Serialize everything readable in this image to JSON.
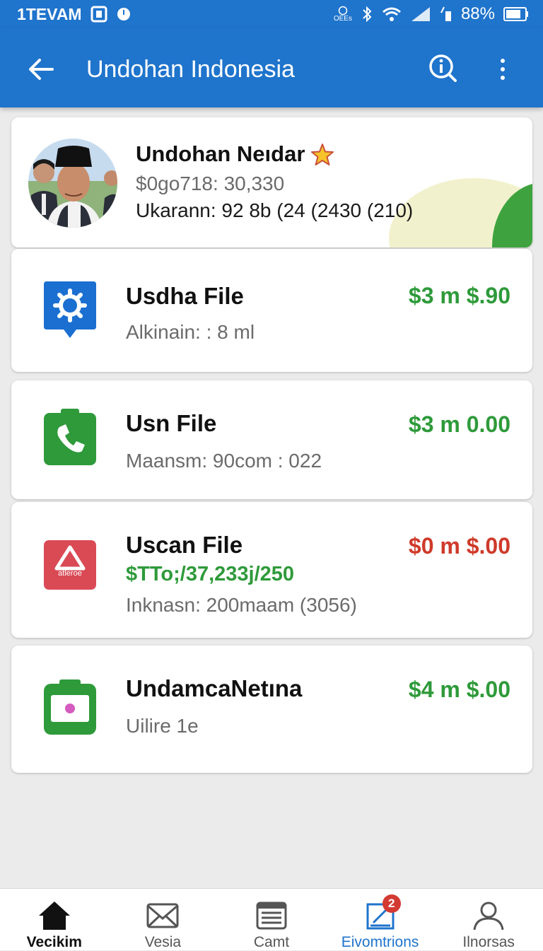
{
  "status_bar": {
    "time": "1TEVAM",
    "mini_label": "OEEs",
    "battery": "88%"
  },
  "app_bar": {
    "title": "Undohan Indonesia",
    "back_icon": "arrow-left-icon",
    "info_icon": "info-search-icon",
    "menu_icon": "more-vertical-icon",
    "color": "#1f74cc"
  },
  "profile": {
    "name": "Undohan Neıdar",
    "line1": "$0go718: 30,330",
    "line2": "Ukarann: 92 8b (24 (2430 (210)"
  },
  "files": [
    {
      "title": "Usdha File",
      "amount": "$3 m $.90",
      "amount_color": "green",
      "subtitle": "Alkinain: : 8 ml",
      "icon": "gear-icon"
    },
    {
      "title": "Usn File",
      "amount": "$3 m 0.00",
      "amount_color": "green",
      "subtitle": "Maansm: 90com : 022",
      "icon": "phone-icon"
    },
    {
      "title": "Uscan File",
      "amount": "$0 m $.00",
      "amount_color": "red",
      "extra": "$TTo;/37,233j/250",
      "subtitle": "Inknasn: 200maam (3056)",
      "icon": "warning-app-icon",
      "icon_text": "atleroe"
    },
    {
      "title": "UndamcaNetına",
      "amount": "$4 m $.00",
      "amount_color": "green",
      "subtitle": "Uilire 1e",
      "icon": "camera-icon"
    }
  ],
  "bottom_nav": [
    {
      "label": "Vecikim",
      "icon": "home-icon"
    },
    {
      "label": "Vesia",
      "icon": "mail-icon"
    },
    {
      "label": "Camt",
      "icon": "list-card-icon"
    },
    {
      "label": "Eivomtrions",
      "icon": "edit-box-icon",
      "badge": "2"
    },
    {
      "label": "Ilnorsas",
      "icon": "person-icon"
    }
  ]
}
